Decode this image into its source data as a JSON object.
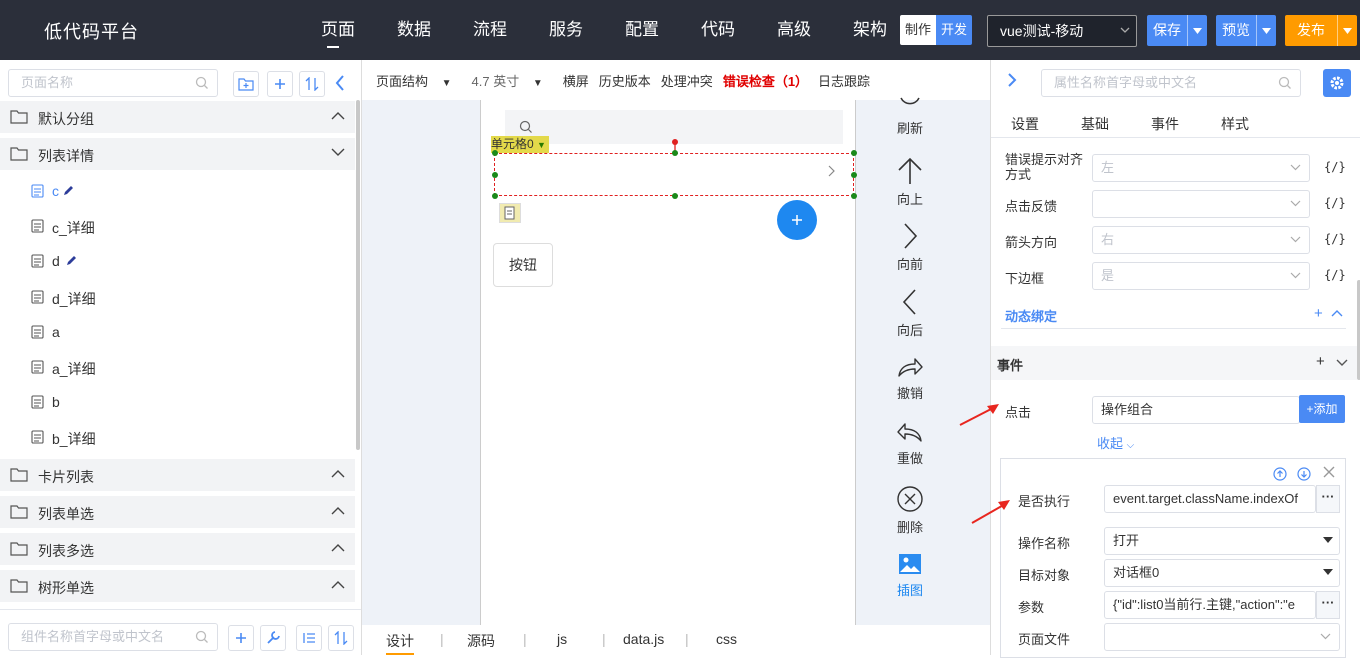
{
  "app": {
    "logo": "低代码平台"
  },
  "topnav": [
    {
      "label": "页面",
      "active": true
    },
    {
      "label": "数据"
    },
    {
      "label": "流程"
    },
    {
      "label": "服务"
    },
    {
      "label": "配置"
    },
    {
      "label": "代码"
    },
    {
      "label": "高级"
    },
    {
      "label": "架构"
    }
  ],
  "mode": {
    "make": "制作",
    "dev": "开发"
  },
  "project": {
    "selected": "vue测试-移动"
  },
  "actions": {
    "save": "保存",
    "preview": "预览",
    "publish": "发布"
  },
  "colors": {
    "accent": "#4a8af4",
    "publish": "#ff9b00",
    "topbar": "#2b2f3a",
    "error": "#e00000",
    "arrow": "#e8261f"
  },
  "left": {
    "search_placeholder": "页面名称",
    "groups": [
      {
        "label": "默认分组",
        "expanded": false
      },
      {
        "label": "列表详情",
        "expanded": true,
        "items": [
          {
            "label": "c",
            "editing": true
          },
          {
            "label": "c_详细"
          },
          {
            "label": "d",
            "editing": true
          },
          {
            "label": "d_详细"
          },
          {
            "label": "a"
          },
          {
            "label": "a_详细"
          },
          {
            "label": "b"
          },
          {
            "label": "b_详细"
          }
        ]
      },
      {
        "label": "卡片列表",
        "expanded": false
      },
      {
        "label": "列表单选",
        "expanded": false
      },
      {
        "label": "列表多选",
        "expanded": false
      },
      {
        "label": "树形单选",
        "expanded": false
      }
    ],
    "component_placeholder": "组件名称首字母或中文名"
  },
  "canvas": {
    "toolbar": {
      "structure": "页面结构",
      "size": "4.7 英寸",
      "landscape": "横屏",
      "history": "历史版本",
      "conflict": "处理冲突",
      "errors": "错误检查（1）",
      "logs": "日志跟踪"
    },
    "cell_tag": "单元格0",
    "button_label": "按钮",
    "side_tools": [
      "刷新",
      "向上",
      "向前",
      "向后",
      "撤销",
      "重做",
      "删除",
      "插图"
    ],
    "bottom_tabs": [
      "设计",
      "源码",
      "js",
      "data.js",
      "css"
    ],
    "active_bottom_tab": "设计"
  },
  "right": {
    "search_placeholder": "属性名称首字母或中文名",
    "tabs": [
      "设置",
      "基础",
      "事件",
      "样式"
    ],
    "props": [
      {
        "label": "错误提示对齐方式",
        "value": "左"
      },
      {
        "label": "点击反馈",
        "value": ""
      },
      {
        "label": "箭头方向",
        "value": "右"
      },
      {
        "label": "下边框",
        "value": "是"
      }
    ],
    "fx": "{/}",
    "dynamic_binding": "动态绑定",
    "events_section": "事件",
    "event": {
      "label": "点击",
      "value": "操作组合",
      "add": "+添加",
      "collapse": "收起"
    },
    "action": {
      "condition_label": "是否执行",
      "condition_value": "event.target.className.indexOf",
      "name_label": "操作名称",
      "name_value": "打开",
      "target_label": "目标对象",
      "target_value": "对话框0",
      "params_label": "参数",
      "params_value": "{\"id\":list0当前行.主键,\"action\":\"e",
      "file_label": "页面文件",
      "file_value": ""
    }
  }
}
